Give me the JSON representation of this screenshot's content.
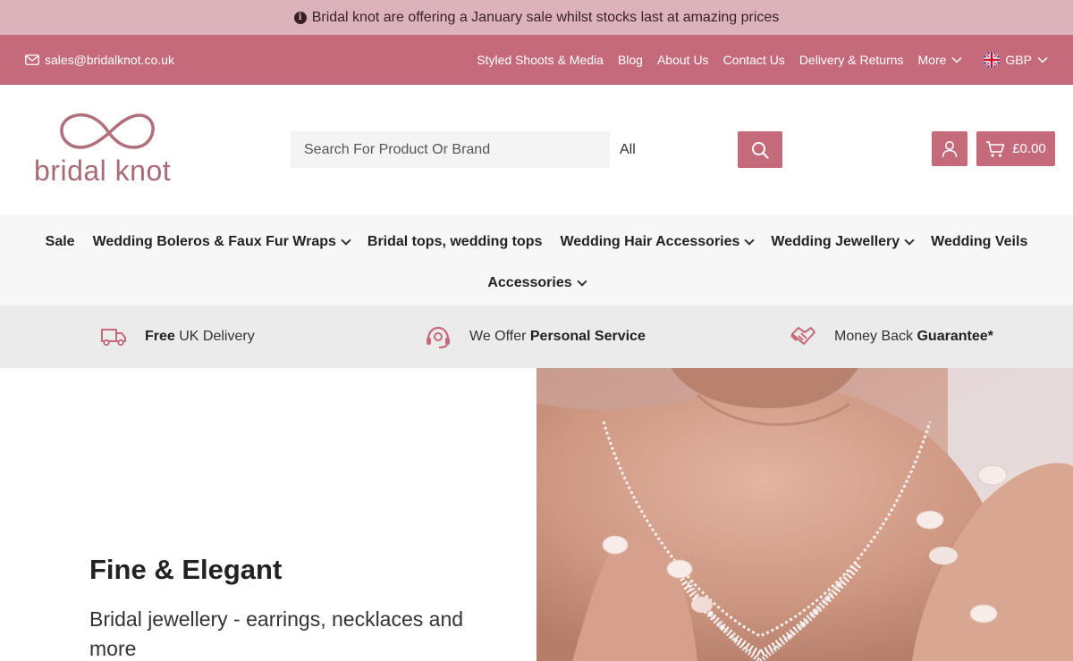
{
  "announcement": {
    "text": "Bridal knot are offering a January sale whilst stocks last at amazing prices",
    "icon": "info-icon"
  },
  "topbar": {
    "email": "sales@bridalknot.co.uk",
    "links": [
      "Styled Shoots & Media",
      "Blog",
      "About Us",
      "Contact Us",
      "Delivery & Returns",
      "More"
    ],
    "currency": "GBP"
  },
  "header": {
    "logo_text": "bridal knot",
    "search_placeholder": "Search For Product Or Brand",
    "search_category": "All",
    "cart_total": "£0.00"
  },
  "nav": {
    "items": [
      {
        "label": "Sale",
        "dropdown": false
      },
      {
        "label": "Wedding Boleros & Faux Fur Wraps",
        "dropdown": true
      },
      {
        "label": "Bridal tops, wedding tops",
        "dropdown": false
      },
      {
        "label": "Wedding Hair Accessories",
        "dropdown": true
      },
      {
        "label": "Wedding Jewellery",
        "dropdown": true
      },
      {
        "label": "Wedding Veils",
        "dropdown": false
      },
      {
        "label": "Accessories",
        "dropdown": true
      }
    ]
  },
  "features": [
    {
      "bold": "Free",
      "rest": " UK Delivery",
      "icon": "truck-icon"
    },
    {
      "pre": "We Offer ",
      "bold": "Personal Service",
      "icon": "headset-icon"
    },
    {
      "pre": "Money Back ",
      "bold": "Guarantee*",
      "icon": "handshake-icon"
    }
  ],
  "hero": {
    "title": "Fine & Elegant",
    "subtitle": "Bridal jewellery - earrings, necklaces and more"
  },
  "colors": {
    "brand": "#c56a7a",
    "announce_bg": "#dcb2bb",
    "nav_bg": "#f7f7f7",
    "feature_bg": "#ebebeb"
  }
}
